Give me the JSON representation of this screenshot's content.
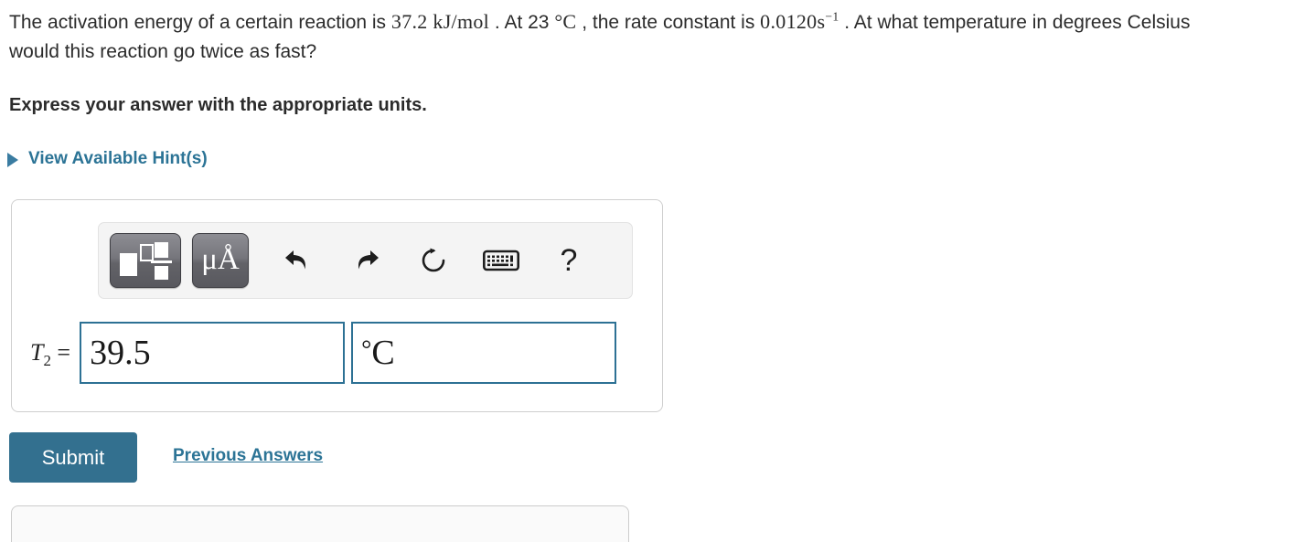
{
  "question": {
    "part1": "The activation energy of a certain reaction is ",
    "value_ea": "37.2 kJ/mol",
    "part2": " . At 23 ",
    "value_temp": "°C",
    "part3": " , the rate constant is ",
    "value_k": "0.0120s",
    "value_k_exp": "−1",
    "part4": " . At what temperature in degrees Celsius would this reaction go twice as fast?"
  },
  "instruction": "Express your answer with the appropriate units.",
  "hints": {
    "label": "View Available Hint(s)",
    "triangle_icon": "triangle-right-icon",
    "color": "#2c7496"
  },
  "toolbar": {
    "buttons": [
      {
        "name": "math-template-button",
        "icon": "math-template-icon",
        "label": ""
      },
      {
        "name": "units-button",
        "icon": "mu-angstrom-icon",
        "label": "μÅ"
      },
      {
        "name": "undo-button",
        "icon": "undo-arrow-icon",
        "label": ""
      },
      {
        "name": "redo-button",
        "icon": "redo-arrow-icon",
        "label": ""
      },
      {
        "name": "reset-button",
        "icon": "reset-circular-arrow-icon",
        "label": ""
      },
      {
        "name": "keyboard-button",
        "icon": "keyboard-icon",
        "label": ""
      },
      {
        "name": "help-button",
        "icon": "question-mark-icon",
        "label": "?"
      }
    ]
  },
  "answer": {
    "variable_label": "T",
    "variable_subscript": "2",
    "equals": "=",
    "value": "39.5",
    "value_placeholder": "",
    "units_degree": "°",
    "units_symbol": "C",
    "units_placeholder": ""
  },
  "actions": {
    "submit_label": "Submit",
    "previous_answers_label": "Previous Answers",
    "submit_color": "#33708f",
    "link_color": "#2c7496"
  }
}
